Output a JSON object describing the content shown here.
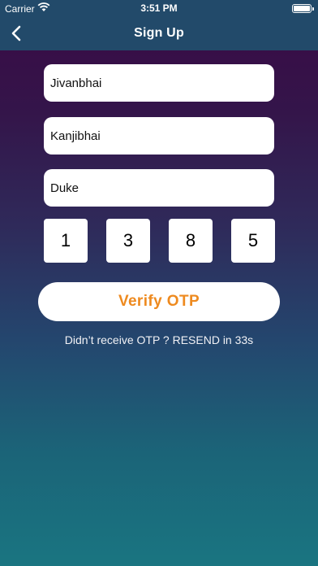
{
  "status_bar": {
    "carrier": "Carrier",
    "time": "3:51 PM"
  },
  "nav": {
    "title": "Sign Up",
    "back_icon": "chevron-left-icon"
  },
  "form": {
    "first_name": "Jivanbhai",
    "middle_name": "Kanjibhai",
    "last_name": "Duke"
  },
  "otp": {
    "digits": [
      "1",
      "3",
      "8",
      "5"
    ],
    "verify_label": "Verify OTP",
    "resend_text": "Didn’t receive OTP ? RESEND in 33s"
  },
  "colors": {
    "accent": "#ee8a1f",
    "nav_bg": "#224a6a"
  }
}
